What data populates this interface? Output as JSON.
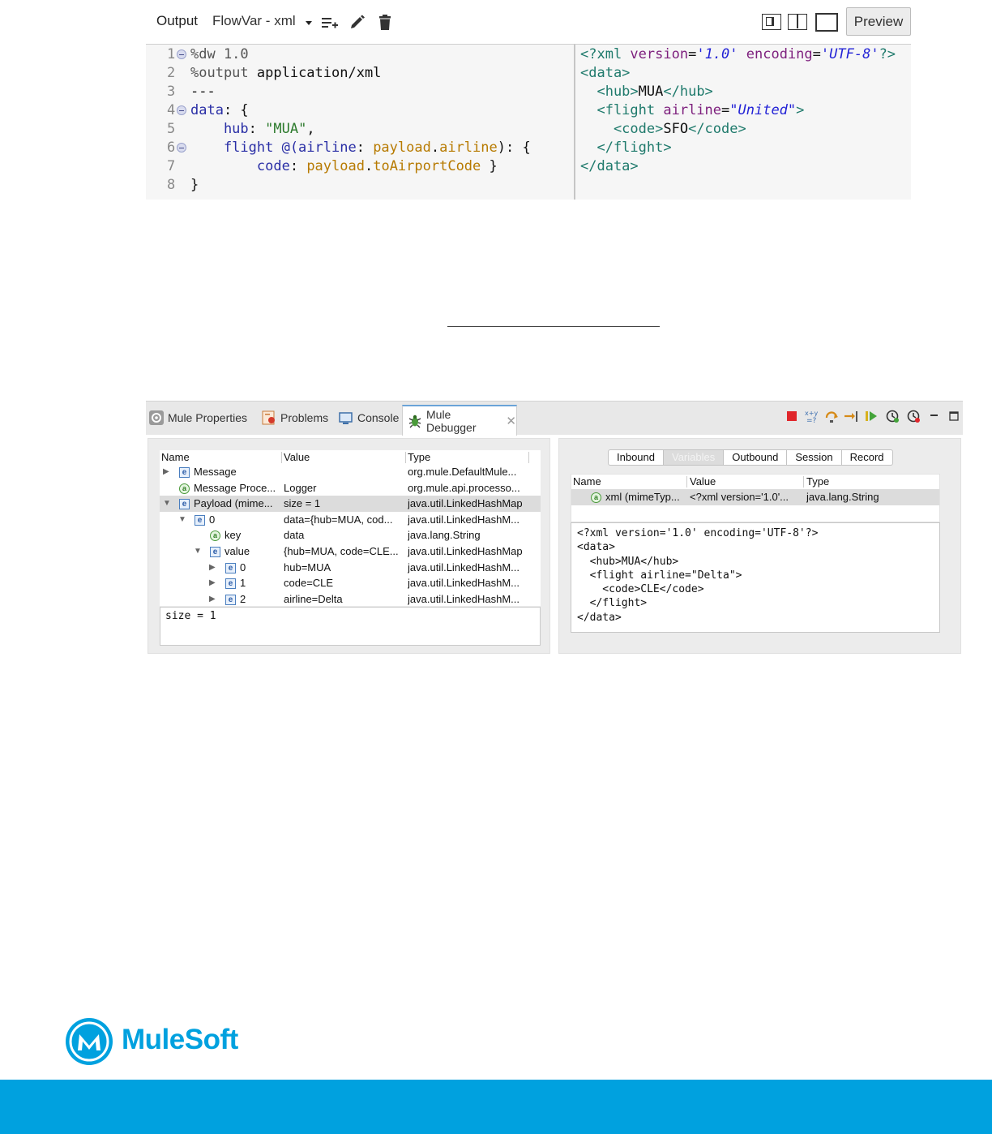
{
  "toolbar": {
    "output_label": "Output",
    "target_label": "FlowVar - xml",
    "preview_label": "Preview",
    "icons": [
      "dropdown-arrow-icon",
      "add-list-icon",
      "pencil-icon",
      "trash-icon",
      "layout-split-icon",
      "layout-columns-icon",
      "layout-single-icon"
    ]
  },
  "editor": {
    "lines": [
      {
        "num": "1",
        "fold": true,
        "tokens": [
          {
            "t": "%dw 1.0",
            "c": "dir"
          }
        ]
      },
      {
        "num": "2",
        "fold": false,
        "tokens": [
          {
            "t": "%output ",
            "c": "dir"
          },
          {
            "t": "application/xml",
            "c": "plain"
          }
        ]
      },
      {
        "num": "3",
        "fold": false,
        "tokens": [
          {
            "t": "---",
            "c": "plain"
          }
        ]
      },
      {
        "num": "4",
        "fold": true,
        "tokens": [
          {
            "t": "data",
            "c": "kw"
          },
          {
            "t": ": {",
            "c": "plain"
          }
        ]
      },
      {
        "num": "5",
        "fold": false,
        "tokens": [
          {
            "t": "    hub",
            "c": "kw"
          },
          {
            "t": ": ",
            "c": "plain"
          },
          {
            "t": "\"MUA\"",
            "c": "str"
          },
          {
            "t": ",",
            "c": "plain"
          }
        ]
      },
      {
        "num": "6",
        "fold": true,
        "tokens": [
          {
            "t": "    flight @(airline",
            "c": "kw"
          },
          {
            "t": ": ",
            "c": "plain"
          },
          {
            "t": "payload",
            "c": "fn"
          },
          {
            "t": ".",
            "c": "plain"
          },
          {
            "t": "airline",
            "c": "fn"
          },
          {
            "t": "): {",
            "c": "plain"
          }
        ]
      },
      {
        "num": "7",
        "fold": false,
        "tokens": [
          {
            "t": "        code",
            "c": "kw"
          },
          {
            "t": ": ",
            "c": "plain"
          },
          {
            "t": "payload",
            "c": "fn"
          },
          {
            "t": ".",
            "c": "plain"
          },
          {
            "t": "toAirportCode",
            "c": "fn"
          },
          {
            "t": " }",
            "c": "plain"
          }
        ]
      },
      {
        "num": "8",
        "fold": false,
        "tokens": [
          {
            "t": "}",
            "c": "plain"
          }
        ]
      }
    ]
  },
  "output_preview": {
    "lines": [
      [
        {
          "t": "<?xml ",
          "c": "tag"
        },
        {
          "t": "version",
          "c": "attr"
        },
        {
          "t": "=",
          "c": "plain"
        },
        {
          "t": "'1.0'",
          "c": "val"
        },
        {
          "t": " ",
          "c": "plain"
        },
        {
          "t": "encoding",
          "c": "attr"
        },
        {
          "t": "=",
          "c": "plain"
        },
        {
          "t": "'UTF-8'",
          "c": "val"
        },
        {
          "t": "?>",
          "c": "tag"
        }
      ],
      [
        {
          "t": "<data>",
          "c": "tag"
        }
      ],
      [
        {
          "t": "  <hub>",
          "c": "tag"
        },
        {
          "t": "MUA",
          "c": "plain"
        },
        {
          "t": "</hub>",
          "c": "tag"
        }
      ],
      [
        {
          "t": "  <flight ",
          "c": "tag"
        },
        {
          "t": "airline",
          "c": "attr"
        },
        {
          "t": "=",
          "c": "plain"
        },
        {
          "t": "\"United\"",
          "c": "val"
        },
        {
          "t": ">",
          "c": "tag"
        }
      ],
      [
        {
          "t": "    <code>",
          "c": "tag"
        },
        {
          "t": "SFO",
          "c": "plain"
        },
        {
          "t": "</code>",
          "c": "tag"
        }
      ],
      [
        {
          "t": "  </flight>",
          "c": "tag"
        }
      ],
      [
        {
          "t": "</data>",
          "c": "tag"
        }
      ]
    ]
  },
  "debugger_tabs": [
    {
      "label": "Mule Properties",
      "icon": "gear-icon"
    },
    {
      "label": "Problems",
      "icon": "problems-icon"
    },
    {
      "label": "Console",
      "icon": "console-icon"
    },
    {
      "label": "Mule Debugger",
      "icon": "bug-icon",
      "active": true
    }
  ],
  "debugger_actions": [
    "stop-icon",
    "evaluate-expression-icon",
    "step-over-icon",
    "step-into-icon",
    "resume-icon",
    "run-to-processor-icon",
    "clock-stop-icon",
    "minimize-icon",
    "maximize-icon"
  ],
  "message_tree": {
    "headers": [
      "Name",
      "Value",
      "Type"
    ],
    "rows": [
      {
        "depth": 0,
        "twisty": "▶",
        "icon": "e",
        "name": "Message",
        "value": "",
        "type": "org.mule.DefaultMule..."
      },
      {
        "depth": 0,
        "twisty": "",
        "icon": "a",
        "name": "Message Proce...",
        "value": "Logger",
        "type": "org.mule.api.processo..."
      },
      {
        "depth": 0,
        "twisty": "▼",
        "icon": "e",
        "name": "Payload (mime...",
        "value": "size = 1",
        "type": "java.util.LinkedHashMap",
        "selected": true
      },
      {
        "depth": 1,
        "twisty": "▼",
        "icon": "e",
        "name": "0",
        "value": "data={hub=MUA, cod...",
        "type": "java.util.LinkedHashM..."
      },
      {
        "depth": 2,
        "twisty": "",
        "icon": "a",
        "name": "key",
        "value": "data",
        "type": "java.lang.String"
      },
      {
        "depth": 2,
        "twisty": "▼",
        "icon": "e",
        "name": "value",
        "value": "{hub=MUA, code=CLE...",
        "type": "java.util.LinkedHashMap"
      },
      {
        "depth": 3,
        "twisty": "▶",
        "icon": "e",
        "name": "0",
        "value": "hub=MUA",
        "type": "java.util.LinkedHashM..."
      },
      {
        "depth": 3,
        "twisty": "▶",
        "icon": "e",
        "name": "1",
        "value": "code=CLE",
        "type": "java.util.LinkedHashM..."
      },
      {
        "depth": 3,
        "twisty": "▶",
        "icon": "e",
        "name": "2",
        "value": "airline=Delta",
        "type": "java.util.LinkedHashM..."
      }
    ],
    "detail": "size = 1"
  },
  "scope_tabs": [
    "Inbound",
    "Variables",
    "Outbound",
    "Session",
    "Record"
  ],
  "variables": {
    "headers": [
      "Name",
      "Value",
      "Type"
    ],
    "rows": [
      {
        "icon": "a",
        "name": "xml (mimeTyp...",
        "value": "<?xml version='1.0'...",
        "type": "java.lang.String"
      }
    ],
    "xml_text": [
      "<?xml version='1.0' encoding='UTF-8'?>",
      "<data>",
      "  <hub>MUA</hub>",
      "  <flight airline=\"Delta\">",
      "    <code>CLE</code>",
      "  </flight>",
      "</data>"
    ]
  },
  "brand": {
    "name": "MuleSoft",
    "tm": "®",
    "color": "#00a1df"
  }
}
